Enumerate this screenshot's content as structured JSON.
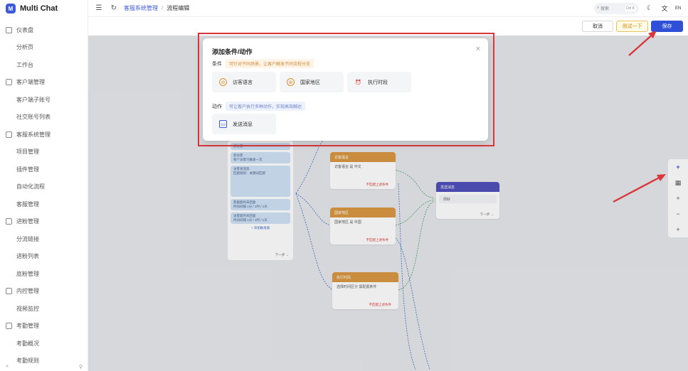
{
  "brand": {
    "name": "Multi Chat",
    "logo_text": "M"
  },
  "sidebar": {
    "items": [
      {
        "label": "仪表盘",
        "type": "group"
      },
      {
        "label": "分析页",
        "type": "sub"
      },
      {
        "label": "工作台",
        "type": "sub"
      },
      {
        "label": "客户端管理",
        "type": "group"
      },
      {
        "label": "客户端子账号",
        "type": "sub"
      },
      {
        "label": "社交账号列表",
        "type": "sub"
      },
      {
        "label": "客服系统管理",
        "type": "group"
      },
      {
        "label": "项目管理",
        "type": "sub"
      },
      {
        "label": "插件管理",
        "type": "sub"
      },
      {
        "label": "自动化流程",
        "type": "sub"
      },
      {
        "label": "客服管理",
        "type": "sub"
      },
      {
        "label": "进粉管理",
        "type": "group"
      },
      {
        "label": "分流链接",
        "type": "sub"
      },
      {
        "label": "进粉列表",
        "type": "sub"
      },
      {
        "label": "底粉管理",
        "type": "sub"
      },
      {
        "label": "内控管理",
        "type": "group"
      },
      {
        "label": "视频监控",
        "type": "sub"
      },
      {
        "label": "考勤管理",
        "type": "group"
      },
      {
        "label": "考勤概况",
        "type": "sub"
      },
      {
        "label": "考勤规则",
        "type": "sub"
      }
    ],
    "collapse_icon": "«"
  },
  "topbar": {
    "breadcrumb_parent": "客服系统管理",
    "breadcrumb_sep": "/",
    "breadcrumb_current": "流程编辑",
    "search_placeholder": "搜索",
    "search_shortcut": "Ctrl K",
    "lang": "EN"
  },
  "actions": {
    "cancel": "取消",
    "test": "测试一下",
    "save": "保存"
  },
  "modal": {
    "title": "添加条件/动作",
    "condition_label": "条件",
    "condition_hint": "可针对不同场景，让客户触发不同流程分支",
    "conditions": [
      "访客语言",
      "国家地区",
      "执行时段"
    ],
    "action_label": "动作",
    "action_hint": "可让客户执行多种动作，实现高效触达",
    "actions": [
      "发送消息"
    ]
  },
  "flow": {
    "start_items": [
      {
        "title": "新访客",
        "desc": ""
      },
      {
        "title": "新访客",
        "desc": "每个访客只触发一次"
      },
      {
        "title": "访客发消息",
        "desc": "匹配规则：关键词匹配"
      },
      {
        "title": "客服超时未回复",
        "desc": "时间间隔 1分 / 1时 / 1天"
      },
      {
        "title": "访客超时未回复",
        "desc": "时间间隔 1分 / 1时 / 1天"
      }
    ],
    "start_add": "+ 添加触发器",
    "start_next": "下一步 →",
    "lang_node": {
      "title": "访客语言",
      "row": "访客语言 是 中文",
      "foot": "不匹配上述条件"
    },
    "region_node": {
      "title": "国家地区",
      "row": "国家地区 是 中国",
      "foot": "不匹配上述条件"
    },
    "time_node": {
      "title": "执行时段",
      "row": "选择时间区分 需配置条件",
      "foot": "不匹配上述条件"
    },
    "msg_node": {
      "title": "发送消息",
      "row": "你好",
      "next": "下一步 →"
    }
  },
  "colors": {
    "accent": "#2f4fd6",
    "highlight": "#d9373a",
    "condition_node": "#d9953a",
    "message_node": "#4a4ab8"
  }
}
